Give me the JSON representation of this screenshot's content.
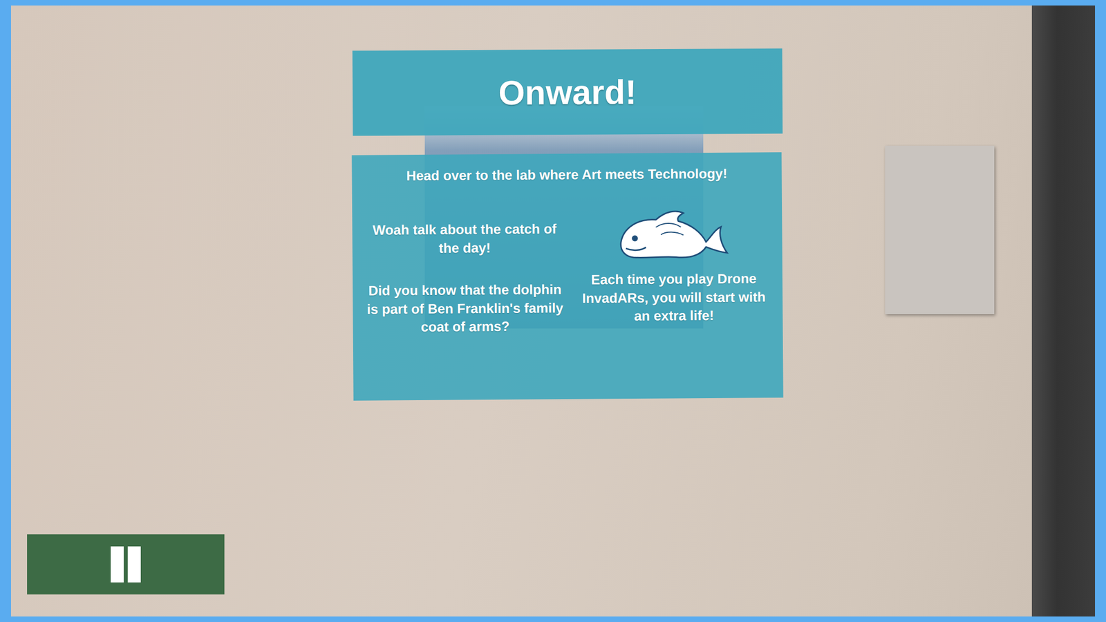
{
  "popup": {
    "title": "Onward!",
    "instruction": "Head over to the lab where Art meets Technology!",
    "catch_message": "Woah talk about the catch of the day!",
    "fact": "Did you know that the dolphin is part of Ben Franklin's family coat of arms?",
    "reward": "Each time you play Drone InvadARs, you will start with an extra life!"
  }
}
